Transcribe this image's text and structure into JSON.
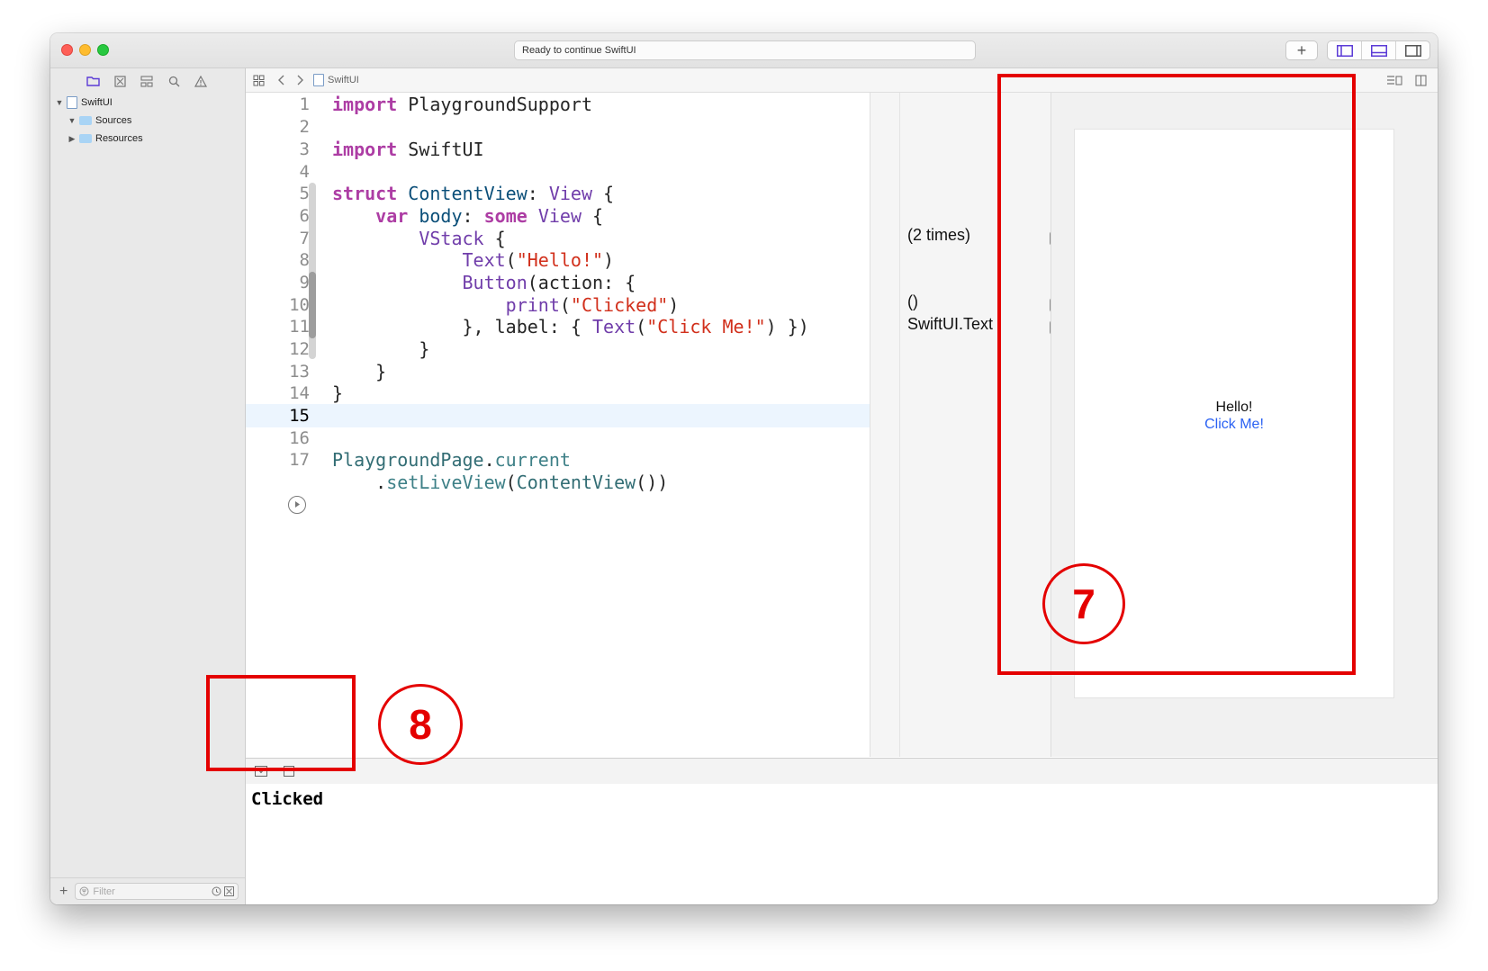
{
  "window": {
    "status_text": "Ready to continue SwiftUI",
    "toolbar_plus": "+"
  },
  "navigator": {
    "tree": [
      {
        "label": "SwiftUI",
        "icon": "playground-file-icon",
        "expanded": true
      },
      {
        "label": "Sources",
        "icon": "folder-icon",
        "expanded": true
      },
      {
        "label": "Resources",
        "icon": "folder-icon",
        "expanded": false
      }
    ],
    "filter_placeholder": "Filter"
  },
  "jumpbar": {
    "file": "SwiftUI"
  },
  "editor": {
    "current_line": 15,
    "lines": [
      {
        "n": "1",
        "code": "import PlaygroundSupport"
      },
      {
        "n": "2",
        "code": ""
      },
      {
        "n": "3",
        "code": "import SwiftUI"
      },
      {
        "n": "4",
        "code": ""
      },
      {
        "n": "5",
        "code": "struct ContentView: View {"
      },
      {
        "n": "6",
        "code": "    var body: some View {"
      },
      {
        "n": "7",
        "code": "        VStack {"
      },
      {
        "n": "8",
        "code": "            Text(\"Hello!\")"
      },
      {
        "n": "9",
        "code": "            Button(action: {"
      },
      {
        "n": "10",
        "code": "                print(\"Clicked\")"
      },
      {
        "n": "11",
        "code": "            }, label: { Text(\"Click Me!\") })"
      },
      {
        "n": "12",
        "code": "        }"
      },
      {
        "n": "13",
        "code": "    }"
      },
      {
        "n": "14",
        "code": "}"
      },
      {
        "n": "15",
        "code": ""
      },
      {
        "n": "16",
        "code": ""
      },
      {
        "n": "17",
        "code": "PlaygroundPage.current"
      },
      {
        "n": "",
        "code": "    .setLiveView(ContentView())"
      }
    ]
  },
  "results": [
    {
      "text": "(2 times)",
      "line": 7
    },
    {
      "text": "()",
      "line": 10
    },
    {
      "text": "SwiftUI.Text",
      "line": 11
    }
  ],
  "live_view": {
    "hello": "Hello!",
    "button": "Click Me!"
  },
  "console": {
    "output": "Clicked"
  },
  "annotations": {
    "seven": "7",
    "eight": "8"
  },
  "colors": {
    "keyword": "#ad3da4",
    "type": "#703daa",
    "string": "#d12f1b",
    "link_blue": "#2b62f3",
    "annotation_red": "#e40000"
  }
}
